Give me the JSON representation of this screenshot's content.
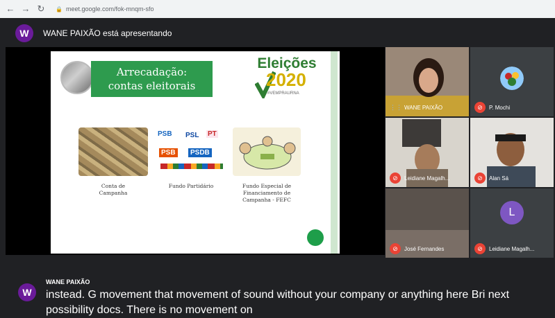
{
  "browser": {
    "back_icon": "arrow-left-icon",
    "forward_icon": "arrow-right-icon",
    "reload_icon": "reload-icon",
    "url": "meet.google.com/fok-mnqm-sfo"
  },
  "presenter": {
    "initial": "W",
    "text": "WANE PAIXÃO está apresentando"
  },
  "slide": {
    "banner_line1": "Arrecadação:",
    "banner_line2": "contas eleitorais",
    "logo_title": "Eleições",
    "logo_year": "2020",
    "logo_tag": "#VEMPRAURNA",
    "parties": [
      "PSB",
      "PSL",
      "PSDB",
      "PT"
    ],
    "captions": [
      "Conta de\nCampanha",
      "Fundo Partidário",
      "Fundo Especial de\nFinanciamento de\nCampanha - FEFC"
    ]
  },
  "participants": [
    {
      "name": "WANE PAIXÃO",
      "muted": false
    },
    {
      "name": "P. Mochi",
      "muted": true
    },
    {
      "name": "Leidiane Magalh...",
      "muted": true
    },
    {
      "name": "Alan Sá",
      "muted": true
    },
    {
      "name": "José Fernandes",
      "muted": true
    },
    {
      "name": "Leidiane Magalh...",
      "muted": true,
      "initial": "L"
    }
  ],
  "caption": {
    "initial": "W",
    "speaker": "WANE PAIXÃO",
    "text": "instead. G movement that movement of sound without your company or anything here Bri next possibility docs. There is no movement on"
  },
  "colors": {
    "meet_bg": "#202124",
    "tile_bg": "#3c4043",
    "muted_red": "#ea4335",
    "avatar_purple": "#6a1b9a",
    "slide_green": "#2e9b4e"
  }
}
